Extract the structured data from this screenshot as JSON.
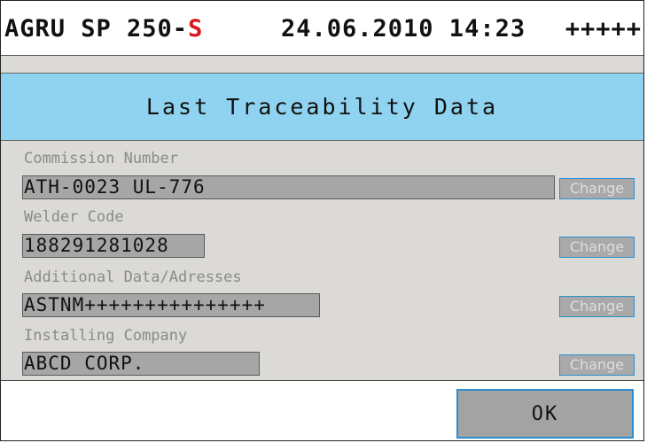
{
  "statusbar": {
    "device_prefix": "AGRU SP 250-",
    "device_suffix": "S",
    "datetime": "24.06.2010 14:23",
    "indicator": "+++++"
  },
  "title": "Last Traceability Data",
  "fields": [
    {
      "label": "Commission Number",
      "value": "ATH-0023 UL-776",
      "button": "Change"
    },
    {
      "label": "Welder Code",
      "value": "188291281028",
      "button": "Change"
    },
    {
      "label": "Additional Data/Adresses",
      "value": "ASTNM+++++++++++++++",
      "button": "Change"
    },
    {
      "label": "Installing Company",
      "value": "ABCD CORP.",
      "button": "Change"
    }
  ],
  "footer": {
    "ok_label": "OK"
  },
  "colors": {
    "title_bg": "#8fd3f0",
    "accent_border": "#2a8fd0",
    "suffix_red": "#d8161c",
    "panel_bg": "#dcdad6"
  }
}
